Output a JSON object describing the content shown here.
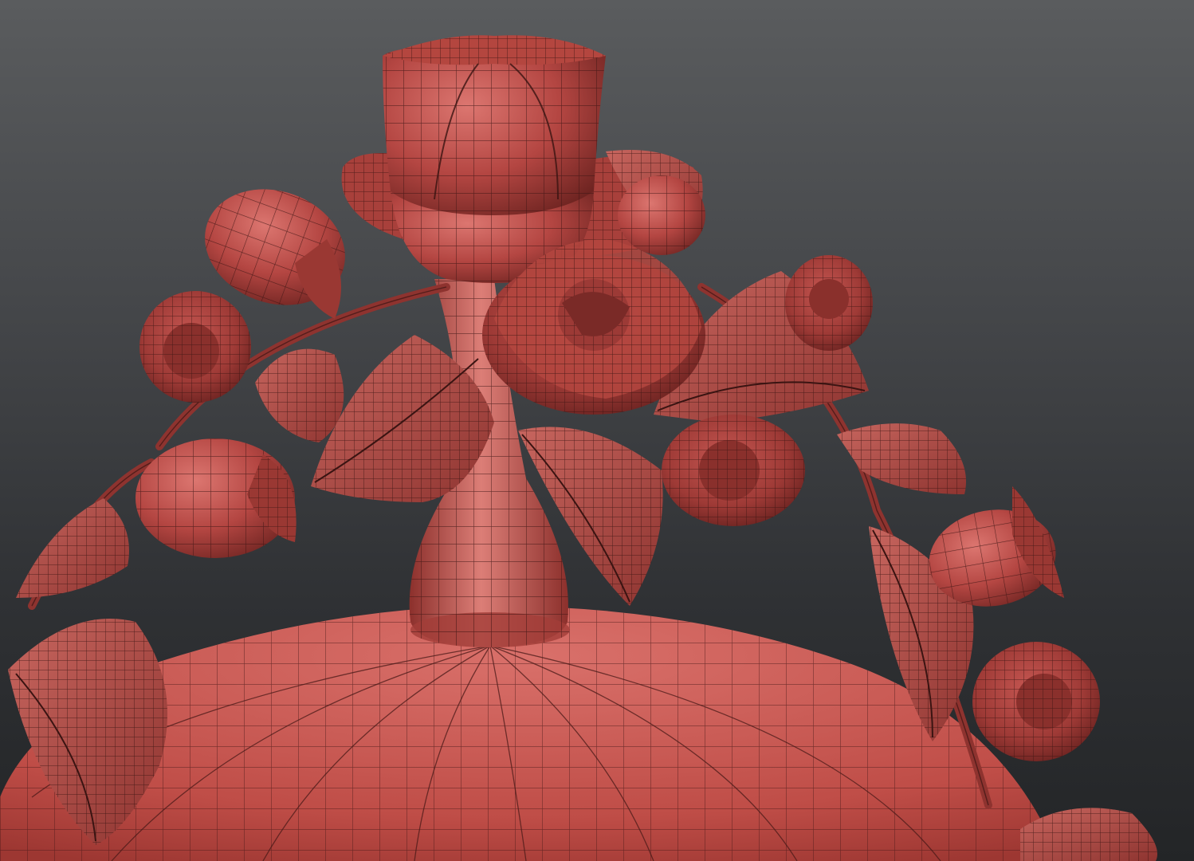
{
  "viewport": {
    "kind": "3d-viewport-render",
    "subject": "wireframe-mesh-sculpture",
    "colors": {
      "background_top": "#5a5c5e",
      "background_bottom": "#232527",
      "mesh_base": "#c0504b",
      "mesh_light": "#d86c66",
      "mesh_shadow": "#7a2a27",
      "wire": "#3a1412"
    }
  }
}
